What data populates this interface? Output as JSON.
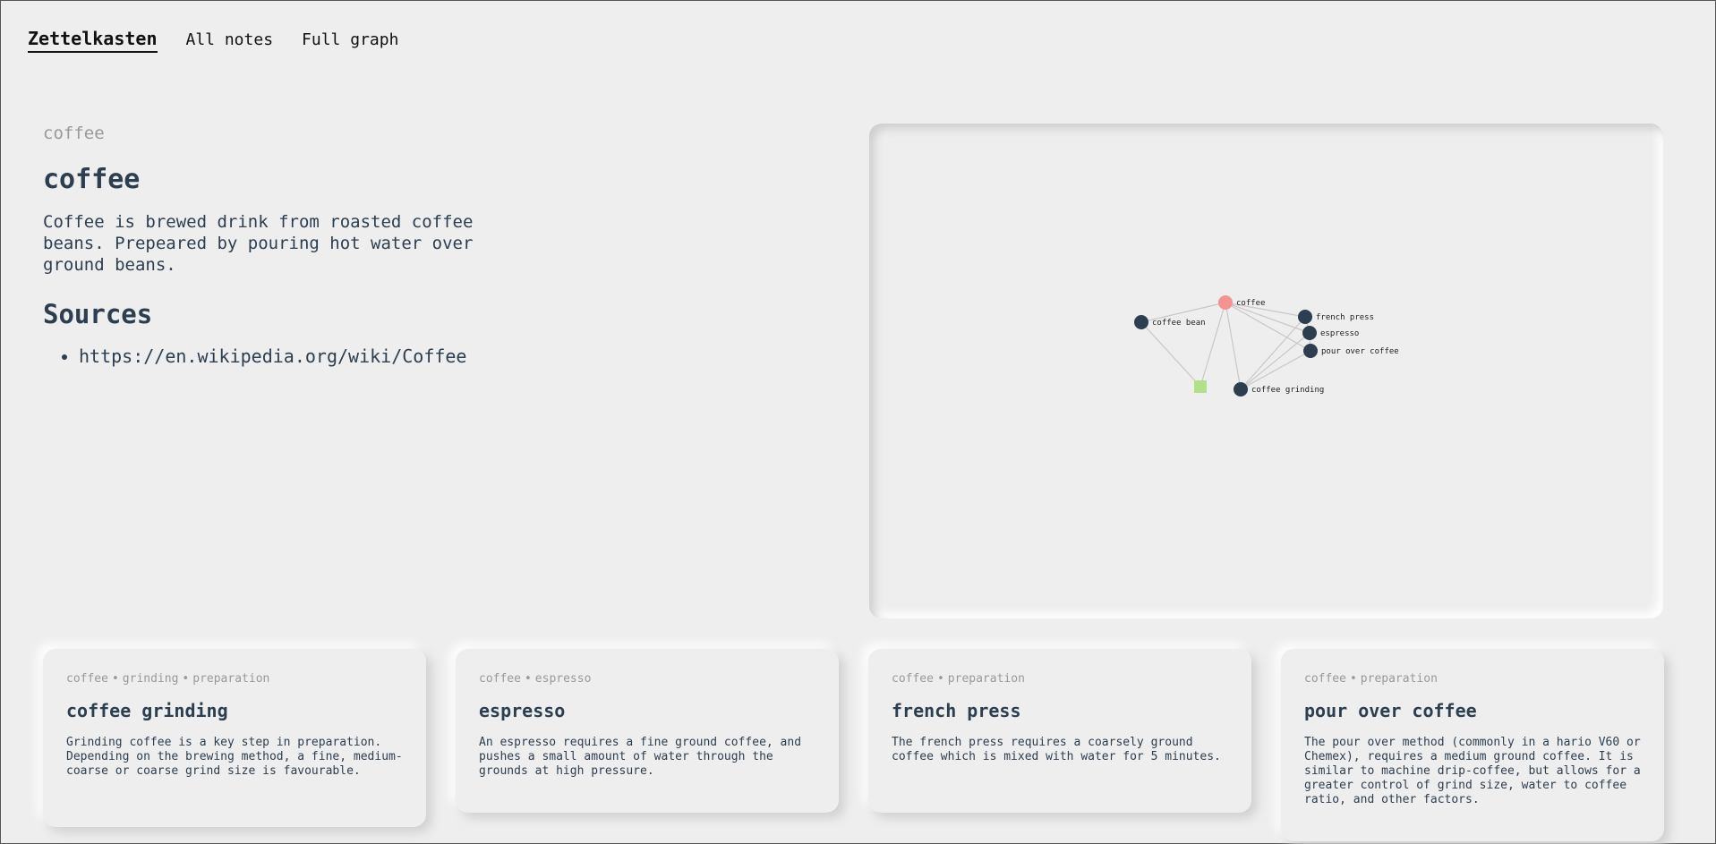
{
  "nav": {
    "brand": "Zettelkasten",
    "links": [
      "All notes",
      "Full graph"
    ]
  },
  "note": {
    "tagline": "coffee",
    "title": "coffee",
    "body": "Coffee is brewed drink from roasted coffee beans. Prepeared by pouring hot water over ground beans.",
    "sources_heading": "Sources",
    "sources": [
      "https://en.wikipedia.org/wiki/Coffee"
    ]
  },
  "graph": {
    "colors": {
      "current": "#f49390",
      "note": "#2c3e50",
      "tag": "#b5de8a",
      "edge": "#c8c8c8"
    },
    "nodes": [
      {
        "label": "coffee",
        "kind": "current"
      },
      {
        "label": "coffee bean",
        "kind": "note"
      },
      {
        "label": "french press",
        "kind": "note"
      },
      {
        "label": "espresso",
        "kind": "note"
      },
      {
        "label": "pour over coffee",
        "kind": "note"
      },
      {
        "label": "coffee grinding",
        "kind": "note"
      },
      {
        "label": "",
        "kind": "tag"
      }
    ]
  },
  "cards": [
    {
      "tags": [
        "coffee",
        "grinding",
        "preparation"
      ],
      "title": "coffee grinding",
      "body": "Grinding coffee is a key step in preparation. Depending on the brewing method, a fine, medium-coarse or coarse grind size is favourable."
    },
    {
      "tags": [
        "coffee",
        "espresso"
      ],
      "title": "espresso",
      "body": "An espresso requires a fine ground coffee, and pushes a small amount of water through the grounds at high pressure."
    },
    {
      "tags": [
        "coffee",
        "preparation"
      ],
      "title": "french press",
      "body": "The french press requires a coarsely ground coffee which is mixed with water for 5 minutes."
    },
    {
      "tags": [
        "coffee",
        "preparation"
      ],
      "title": "pour over coffee",
      "body": "The pour over method (commonly in a hario V60 or Chemex), requires a medium ground coffee. It is similar to machine drip-coffee, but allows for a greater control of grind size, water to coffee ratio, and other factors."
    }
  ]
}
